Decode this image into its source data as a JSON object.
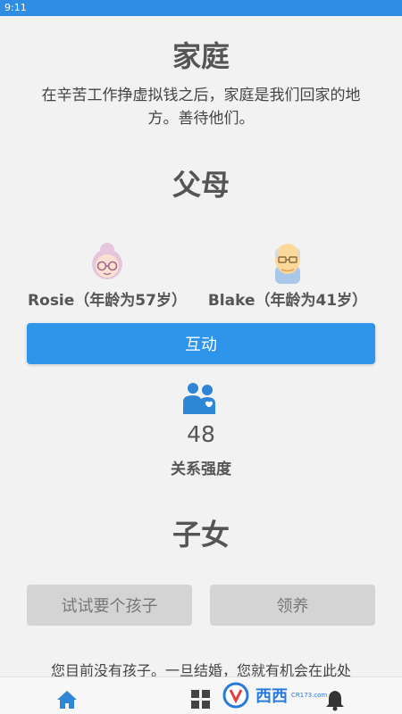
{
  "status_bar": {
    "time": "9:11"
  },
  "family": {
    "title": "家庭",
    "description": "在辛苦工作挣虚拟钱之后，家庭是我们回家的地方。善待他们。"
  },
  "parents": {
    "title": "父母",
    "mother": {
      "label": "Rosie（年龄为57岁）",
      "icon": "grandmother-avatar-icon"
    },
    "father": {
      "label": "Blake（年龄为41岁）",
      "icon": "grandfather-avatar-icon"
    },
    "interact_button": "互动",
    "relationship": {
      "value": "48",
      "label": "关系强度",
      "icon": "relationship-icon"
    }
  },
  "children": {
    "title": "子女",
    "try_button": "试试要个孩子",
    "adopt_button": "领养",
    "description": "您目前没有孩子。一旦结婚，您就有机会在此处"
  },
  "bottom_nav": {
    "items": [
      "home-icon",
      "grid-icon",
      "bell-icon"
    ]
  },
  "watermark": {
    "text": "西西",
    "sub": "CR173.com"
  },
  "colors": {
    "accent": "#2f95eb",
    "status_bar": "#2f8de4",
    "background": "#f2f2f2"
  }
}
